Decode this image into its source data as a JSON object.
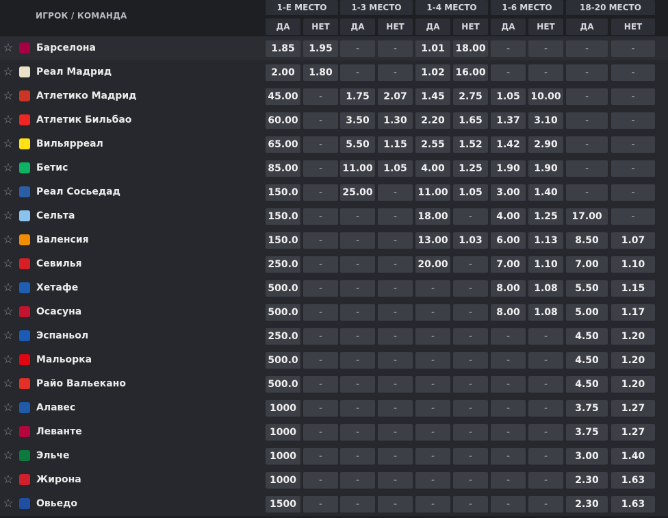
{
  "header": {
    "team_col": "ИГРОК / КОМАНДА",
    "groups": [
      "1-Е МЕСТО",
      "1-3 МЕСТО",
      "1-4 МЕСТО",
      "1-6 МЕСТО",
      "18-20 МЕСТО"
    ],
    "yes": "ДА",
    "no": "НЕТ"
  },
  "icons": {
    "star": "☆"
  },
  "colors": {
    "background": "#1d1f23",
    "odds_cell": "#3c3f46",
    "header_cell": "#2c2f35"
  },
  "rows": [
    {
      "team": "Барселона",
      "logo": "barcelona-logo",
      "color": "#a50044",
      "odds": [
        "1.85",
        "1.95",
        "-",
        "-",
        "1.01",
        "18.00",
        "-",
        "-",
        "-",
        "-"
      ]
    },
    {
      "team": "Реал Мадрид",
      "logo": "real-madrid-logo",
      "color": "#e9e2c7",
      "odds": [
        "2.00",
        "1.80",
        "-",
        "-",
        "1.02",
        "16.00",
        "-",
        "-",
        "-",
        "-"
      ]
    },
    {
      "team": "Атлетико Мадрид",
      "logo": "atletico-madrid-logo",
      "color": "#cb3524",
      "odds": [
        "45.00",
        "-",
        "1.75",
        "2.07",
        "1.45",
        "2.75",
        "1.05",
        "10.00",
        "-",
        "-"
      ]
    },
    {
      "team": "Атлетик Бильбао",
      "logo": "athletic-bilbao-logo",
      "color": "#ee2523",
      "odds": [
        "60.00",
        "-",
        "3.50",
        "1.30",
        "2.20",
        "1.65",
        "1.37",
        "3.10",
        "-",
        "-"
      ]
    },
    {
      "team": "Вильярреал",
      "logo": "villarreal-logo",
      "color": "#ffe114",
      "odds": [
        "65.00",
        "-",
        "5.50",
        "1.15",
        "2.55",
        "1.52",
        "1.42",
        "2.90",
        "-",
        "-"
      ]
    },
    {
      "team": "Бетис",
      "logo": "betis-logo",
      "color": "#0bb363",
      "odds": [
        "85.00",
        "-",
        "11.00",
        "1.05",
        "4.00",
        "1.25",
        "1.90",
        "1.90",
        "-",
        "-"
      ]
    },
    {
      "team": "Реал Сосьедад",
      "logo": "real-sociedad-logo",
      "color": "#2a5fa8",
      "odds": [
        "150.0",
        "-",
        "25.00",
        "-",
        "11.00",
        "1.05",
        "3.00",
        "1.40",
        "-",
        "-"
      ]
    },
    {
      "team": "Сельта",
      "logo": "celta-logo",
      "color": "#8ac3ee",
      "odds": [
        "150.0",
        "-",
        "-",
        "-",
        "18.00",
        "-",
        "4.00",
        "1.25",
        "17.00",
        "-"
      ]
    },
    {
      "team": "Валенсия",
      "logo": "valencia-logo",
      "color": "#f18e00",
      "odds": [
        "150.0",
        "-",
        "-",
        "-",
        "13.00",
        "1.03",
        "6.00",
        "1.13",
        "8.50",
        "1.07"
      ]
    },
    {
      "team": "Севилья",
      "logo": "sevilla-logo",
      "color": "#d81f26",
      "odds": [
        "250.0",
        "-",
        "-",
        "-",
        "20.00",
        "-",
        "7.00",
        "1.10",
        "7.00",
        "1.10"
      ]
    },
    {
      "team": "Хетафе",
      "logo": "getafe-logo",
      "color": "#1e5fb3",
      "odds": [
        "500.0",
        "-",
        "-",
        "-",
        "-",
        "-",
        "8.00",
        "1.08",
        "5.50",
        "1.15"
      ]
    },
    {
      "team": "Осасуна",
      "logo": "osasuna-logo",
      "color": "#c4122f",
      "odds": [
        "500.0",
        "-",
        "-",
        "-",
        "-",
        "-",
        "8.00",
        "1.08",
        "5.00",
        "1.17"
      ]
    },
    {
      "team": "Эспаньол",
      "logo": "espanyol-logo",
      "color": "#1a5bb5",
      "odds": [
        "250.0",
        "-",
        "-",
        "-",
        "-",
        "-",
        "-",
        "-",
        "4.50",
        "1.20"
      ]
    },
    {
      "team": "Мальорка",
      "logo": "mallorca-logo",
      "color": "#e20613",
      "odds": [
        "500.0",
        "-",
        "-",
        "-",
        "-",
        "-",
        "-",
        "-",
        "4.50",
        "1.20"
      ]
    },
    {
      "team": "Райо Вальекано",
      "logo": "rayo-vallecano-logo",
      "color": "#e53027",
      "odds": [
        "500.0",
        "-",
        "-",
        "-",
        "-",
        "-",
        "-",
        "-",
        "4.50",
        "1.20"
      ]
    },
    {
      "team": "Алавес",
      "logo": "alaves-logo",
      "color": "#1f5ba8",
      "odds": [
        "1000",
        "-",
        "-",
        "-",
        "-",
        "-",
        "-",
        "-",
        "3.75",
        "1.27"
      ]
    },
    {
      "team": "Леванте",
      "logo": "levante-logo",
      "color": "#b4053f",
      "odds": [
        "1000",
        "-",
        "-",
        "-",
        "-",
        "-",
        "-",
        "-",
        "3.75",
        "1.27"
      ]
    },
    {
      "team": "Эльче",
      "logo": "elche-logo",
      "color": "#0c7a3e",
      "odds": [
        "1000",
        "-",
        "-",
        "-",
        "-",
        "-",
        "-",
        "-",
        "3.00",
        "1.40"
      ]
    },
    {
      "team": "Жирона",
      "logo": "girona-logo",
      "color": "#d11f2e",
      "odds": [
        "1000",
        "-",
        "-",
        "-",
        "-",
        "-",
        "-",
        "-",
        "2.30",
        "1.63"
      ]
    },
    {
      "team": "Овьедо",
      "logo": "oviedo-logo",
      "color": "#1f4fa3",
      "odds": [
        "1500",
        "-",
        "-",
        "-",
        "-",
        "-",
        "-",
        "-",
        "2.30",
        "1.63"
      ]
    }
  ]
}
